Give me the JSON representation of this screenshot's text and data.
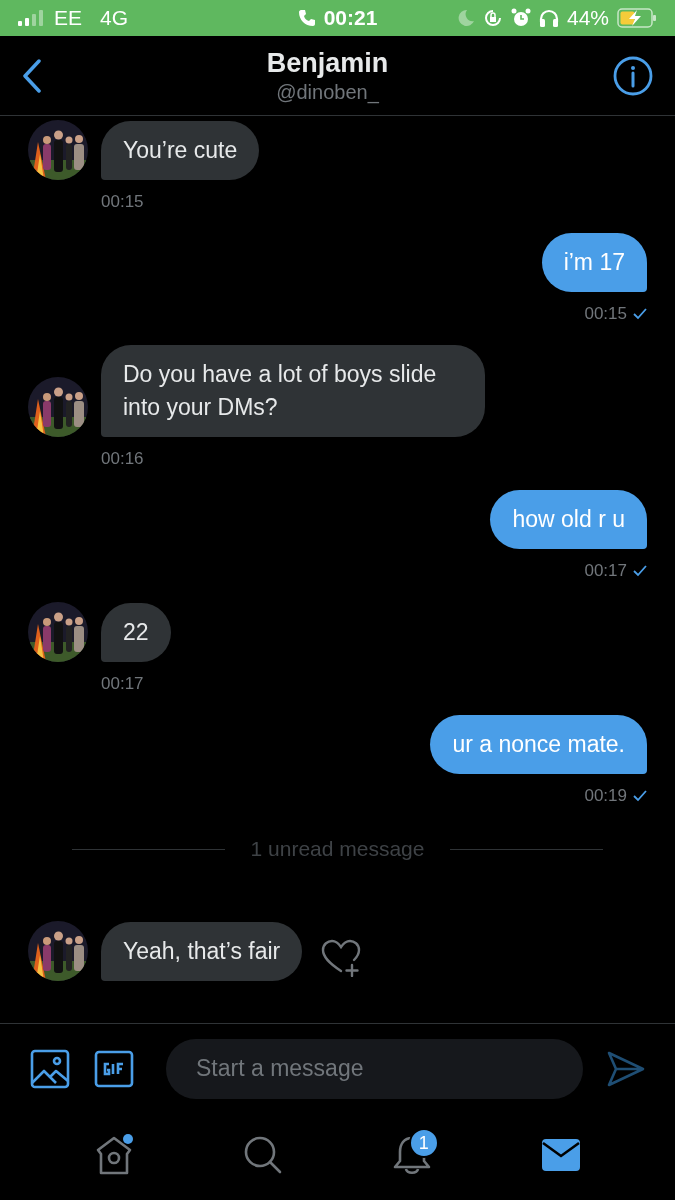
{
  "status_bar": {
    "carrier": "EE",
    "network": "4G",
    "time": "00:21",
    "battery": "44%"
  },
  "header": {
    "name": "Benjamin",
    "handle": "@dinoben_"
  },
  "messages": [
    {
      "kind": "incoming",
      "text": "You’re cute",
      "time": "00:15",
      "like_button": false
    },
    {
      "kind": "outgoing",
      "text": "i’m 17",
      "time": "00:15",
      "delivered": true
    },
    {
      "kind": "incoming",
      "text": "Do you have a lot of boys slide into your DMs?",
      "time": "00:16",
      "like_button": false
    },
    {
      "kind": "outgoing",
      "text": "how old r u",
      "time": "00:17",
      "delivered": true
    },
    {
      "kind": "incoming",
      "text": "22",
      "time": "00:17",
      "like_button": false
    },
    {
      "kind": "outgoing",
      "text": "ur a nonce mate.",
      "time": "00:19",
      "delivered": true
    },
    {
      "kind": "divider",
      "text": "1 unread message"
    },
    {
      "kind": "incoming",
      "text": "Yeah, that’s fair",
      "like_button": true
    }
  ],
  "composer": {
    "placeholder": "Start a message"
  },
  "tabs": [
    {
      "kind": "home",
      "selected": false,
      "dot": true
    },
    {
      "kind": "search",
      "selected": false,
      "dot": false
    },
    {
      "kind": "notifications",
      "selected": false,
      "dot": false,
      "badge": "1"
    },
    {
      "kind": "messages",
      "selected": true,
      "dot": false
    }
  ]
}
